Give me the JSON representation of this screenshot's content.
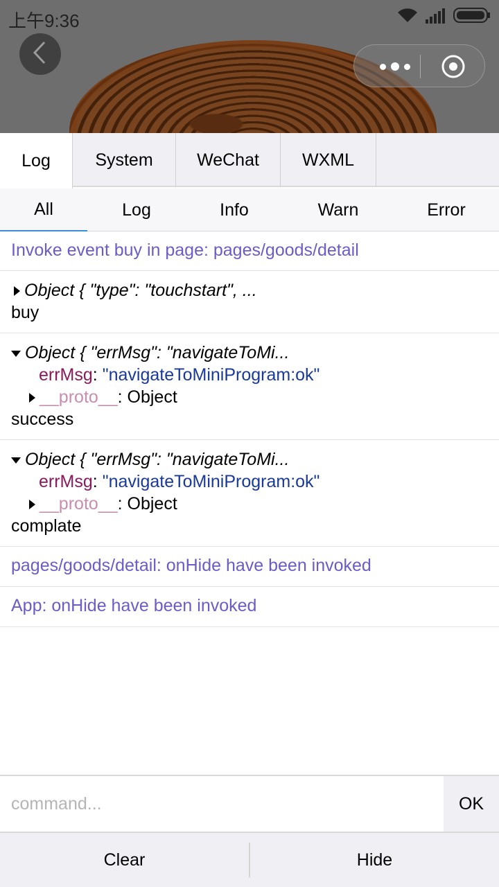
{
  "status_bar": {
    "time": "上午9:36"
  },
  "main_tabs": [
    {
      "label": "Log",
      "active": true
    },
    {
      "label": "System",
      "active": false
    },
    {
      "label": "WeChat",
      "active": false
    },
    {
      "label": "WXML",
      "active": false
    }
  ],
  "sub_tabs": [
    {
      "label": "All",
      "active": true
    },
    {
      "label": "Log",
      "active": false
    },
    {
      "label": "Info",
      "active": false
    },
    {
      "label": "Warn",
      "active": false
    },
    {
      "label": "Error",
      "active": false
    }
  ],
  "logs": {
    "invoke_event": "Invoke event buy in page: pages/goods/detail",
    "entry1": {
      "object_preview": "Object { \"type\": \"touchstart\", ...",
      "message": "buy"
    },
    "entry2": {
      "object_preview": "Object { \"errMsg\": \"navigateToMi...",
      "key": "errMsg",
      "value": "\"navigateToMiniProgram:ok\"",
      "proto_key": "__proto__",
      "proto_value": "Object",
      "message": "success"
    },
    "entry3": {
      "object_preview": "Object { \"errMsg\": \"navigateToMi...",
      "key": "errMsg",
      "value": "\"navigateToMiniProgram:ok\"",
      "proto_key": "__proto__",
      "proto_value": "Object",
      "message": "complate"
    },
    "page_hide": "pages/goods/detail: onHide have been invoked",
    "app_hide": "App: onHide have been invoked"
  },
  "command": {
    "placeholder": "command...",
    "ok_label": "OK"
  },
  "bottom": {
    "clear_label": "Clear",
    "hide_label": "Hide"
  },
  "colors": {
    "info_text": "#6b5cc9",
    "key": "#8a1a5c",
    "string": "#1a3a9a",
    "proto": "#c98db0",
    "active_tab_underline": "#3b8fd8"
  }
}
